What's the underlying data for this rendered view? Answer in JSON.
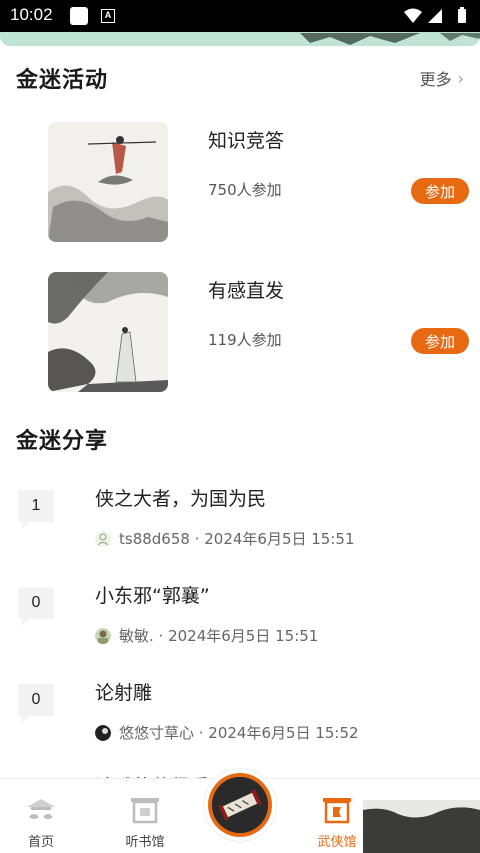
{
  "status_bar": {
    "time": "10:02",
    "notification_letter": "A"
  },
  "activities_section": {
    "title": "金迷活动",
    "more_label": "更多",
    "items": [
      {
        "title": "知识竞答",
        "participants": "750人参加",
        "join_label": "参加"
      },
      {
        "title": "有感直发",
        "participants": "119人参加",
        "join_label": "参加"
      }
    ]
  },
  "shares_section": {
    "title": "金迷分享",
    "items": [
      {
        "count": "1",
        "title": "侠之大者，为国为民",
        "meta": "ts88d658 · 2024年6月5日 15:51"
      },
      {
        "count": "0",
        "title": "小东邪“郭襄”",
        "meta": "敏敏. · 2024年6月5日 15:51"
      },
      {
        "count": "0",
        "title": "论射雕",
        "meta": "悠悠寸草心 · 2024年6月5日 15:52"
      }
    ]
  },
  "bottom_nav": {
    "items": [
      {
        "label": "首页",
        "icon": "home-icon",
        "active": false
      },
      {
        "label": "听书馆",
        "icon": "audiobook-hall-icon",
        "active": false
      },
      {
        "label": "武侠馆",
        "icon": "wuxia-hall-icon",
        "active": true
      }
    ],
    "accent_color": "#e76a13"
  }
}
